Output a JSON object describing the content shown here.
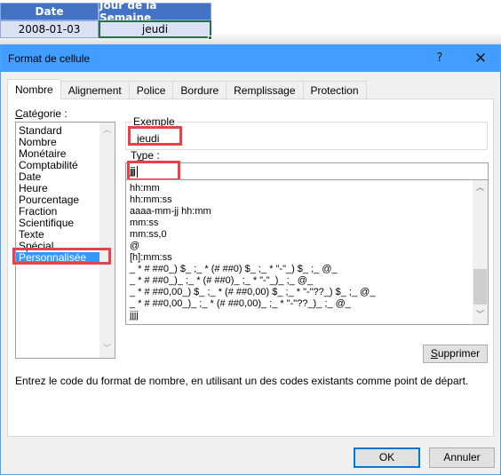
{
  "spreadsheet": {
    "headers": [
      "Date",
      "Jour de la Semaine"
    ],
    "row": [
      "2008-01-03",
      "jeudi"
    ]
  },
  "dialog": {
    "title": "Format de cellule",
    "help_icon": "question-mark-icon",
    "close_icon": "close-x-icon",
    "tabs": [
      {
        "label": "Nombre",
        "active": true
      },
      {
        "label": "Alignement",
        "active": false
      },
      {
        "label": "Police",
        "active": false
      },
      {
        "label": "Bordure",
        "active": false
      },
      {
        "label": "Remplissage",
        "active": false
      },
      {
        "label": "Protection",
        "active": false
      }
    ],
    "category": {
      "label_accel": "C",
      "label_rest": "atégorie :",
      "items": [
        "Standard",
        "Nombre",
        "Monétaire",
        "Comptabilité",
        "Date",
        "Heure",
        "Pourcentage",
        "Fraction",
        "Scientifique",
        "Texte",
        "Spécial",
        "Personnalisée"
      ],
      "selected": "Personnalisée"
    },
    "example": {
      "legend": "Exemple",
      "value": "jeudi"
    },
    "type": {
      "label_pre": "T",
      "label_accel": "y",
      "label_rest": "pe :",
      "value": "jjjj"
    },
    "format_list": {
      "items": [
        "hh:mm",
        "hh:mm:ss",
        "aaaa-mm-jj hh:mm",
        "mm:ss",
        "mm:ss,0",
        "@",
        "[h]:mm:ss",
        "_ * # ##0_) $_ ;_ * (# ##0) $_ ;_ * \"-\"_) $_ ;_ @_",
        "_ * # ##0_)_ ;_ * (# ##0)_ ;_ * \"-\"_)_ ;_ @_",
        "_ * # ##0,00_) $_ ;_ * (# ##0,00) $_ ;_ * \"-\"??_) $_ ;_ @_",
        "_ * # ##0,00_)_ ;_ * (# ##0,00)_ ;_ * \"-\"??_)_ ;_ @_",
        "jjjj"
      ],
      "scroll_position_fraction": 0.85
    },
    "delete_button": {
      "accel": "S",
      "rest": "upprimer"
    },
    "hint": "Entrez le code du format de nombre, en utilisant un des codes existants comme point de départ.",
    "ok_label": "OK",
    "cancel_label": "Annuler"
  },
  "colors": {
    "titlebar": "#419eff",
    "header_fill": "#4472c4",
    "row_fill": "#d9e1f2",
    "active_cell_border": "#217346",
    "selection": "#3399ff",
    "annotation_red": "#e8414a"
  }
}
